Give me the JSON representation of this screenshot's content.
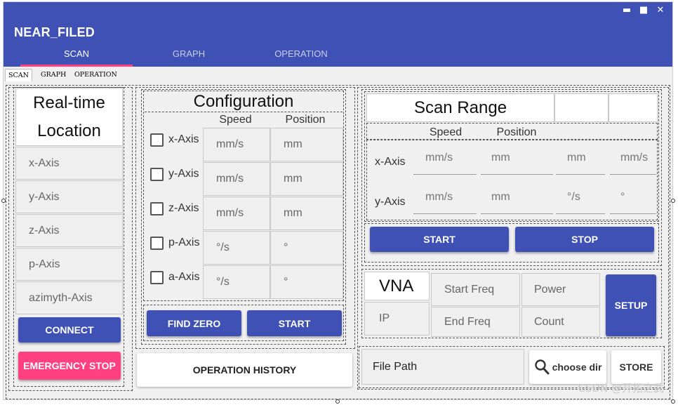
{
  "window": {
    "title": "NEAR_FILED",
    "controls": {
      "minimize": "▬",
      "maximize": "■",
      "close": "✕"
    }
  },
  "main_tabs": [
    {
      "label": "SCAN",
      "active": true
    },
    {
      "label": "GRAPH",
      "active": false
    },
    {
      "label": "OPERATION",
      "active": false
    }
  ],
  "sub_tabs": [
    {
      "label": "SCAN",
      "active": true
    },
    {
      "label": "GRAPH",
      "active": false
    },
    {
      "label": "OPERATION",
      "active": false
    }
  ],
  "realtime": {
    "title_line1": "Real-time",
    "title_line2": "Location",
    "axes": [
      "x-Axis",
      "y-Axis",
      "z-Axis",
      "p-Axis",
      "azimyth-Axis"
    ],
    "connect_label": "CONNECT",
    "emergency_label": "EMERGENCY STOP"
  },
  "configuration": {
    "title": "Configuration",
    "col_speed": "Speed",
    "col_position": "Position",
    "rows": [
      {
        "axis": "x-Axis",
        "speed": "mm/s",
        "position": "mm"
      },
      {
        "axis": "y-Axis",
        "speed": "mm/s",
        "position": "mm"
      },
      {
        "axis": "z-Axis",
        "speed": "mm/s",
        "position": "mm"
      },
      {
        "axis": "p-Axis",
        "speed": "°/s",
        "position": "°"
      },
      {
        "axis": "a-Axis",
        "speed": "°/s",
        "position": "°"
      }
    ],
    "find_zero_label": "FIND ZERO",
    "start_label": "START"
  },
  "operation_history_label": "OPERATION HISTORY",
  "scan_range": {
    "title": "Scan Range",
    "col_speed": "Speed",
    "col_position": "Position",
    "rows": [
      {
        "axis": "x-Axis",
        "speed": "mm/s",
        "position": "mm",
        "c3": "mm",
        "c4": "mm/s"
      },
      {
        "axis": "y-Axis",
        "speed": "mm/s",
        "position": "mm",
        "c3": "°/s",
        "c4": "°"
      }
    ],
    "start_label": "START",
    "stop_label": "STOP"
  },
  "vna": {
    "title": "VNA",
    "ip_label": "IP",
    "start_freq": "Start Freq",
    "end_freq": "End Freq",
    "power": "Power",
    "count": "Count",
    "setup_label": "SETUP"
  },
  "file": {
    "path_label": "File Path",
    "choose_dir_label": "choose dir",
    "store_label": "STORE"
  },
  "watermark": "CSDN @开拓之武"
}
